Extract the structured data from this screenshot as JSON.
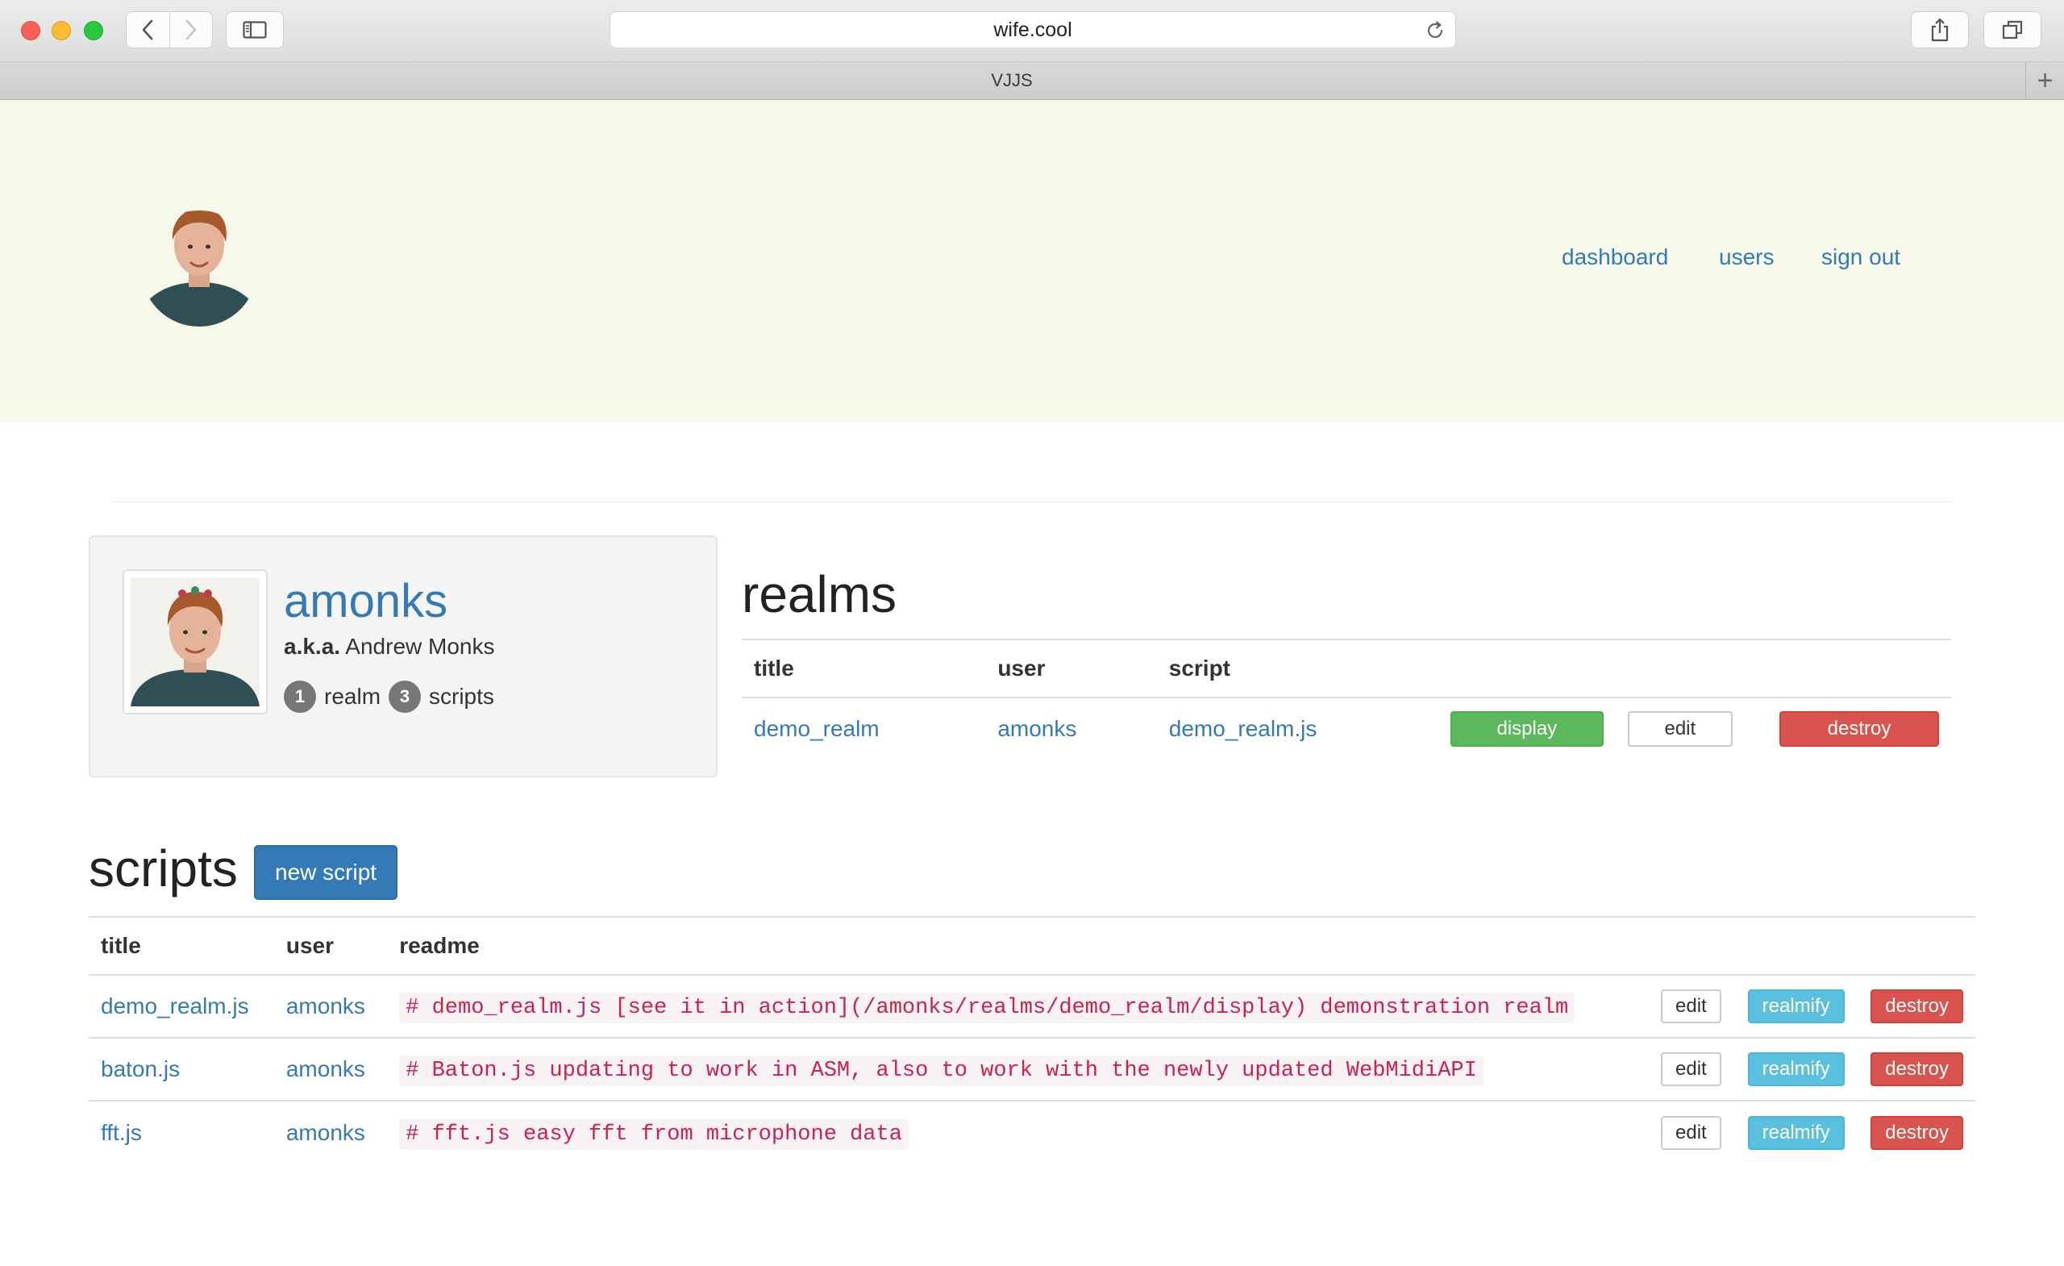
{
  "browser": {
    "url": "wife.cool",
    "tab_title": "VJJS",
    "new_tab_label": "+"
  },
  "nav": {
    "dashboard": "dashboard",
    "users": "users",
    "sign_out": "sign out"
  },
  "profile": {
    "username": "amonks",
    "aka_label": "a.k.a.",
    "real_name": "Andrew Monks",
    "realm_count": "1",
    "realm_word": "realm",
    "script_count": "3",
    "script_word": "scripts"
  },
  "realms": {
    "heading": "realms",
    "columns": {
      "title": "title",
      "user": "user",
      "script": "script"
    },
    "rows": [
      {
        "title": "demo_realm",
        "user": "amonks",
        "script": "demo_realm.js",
        "display": "display",
        "edit": "edit",
        "destroy": "destroy"
      }
    ]
  },
  "scripts": {
    "heading": "scripts",
    "new_button": "new script",
    "columns": {
      "title": "title",
      "user": "user",
      "readme": "readme"
    },
    "rows": [
      {
        "title": "demo_realm.js",
        "user": "amonks",
        "readme": "# demo_realm.js [see it in action](/amonks/realms/demo_realm/display) demonstration realm",
        "edit": "edit",
        "realmify": "realmify",
        "destroy": "destroy"
      },
      {
        "title": "baton.js",
        "user": "amonks",
        "readme": "# Baton.js updating to work in ASM, also to work with the newly updated WebMidiAPI",
        "edit": "edit",
        "realmify": "realmify",
        "destroy": "destroy"
      },
      {
        "title": "fft.js",
        "user": "amonks",
        "readme": "# fft.js easy fft from microphone data",
        "edit": "edit",
        "realmify": "realmify",
        "destroy": "destroy"
      }
    ]
  },
  "colors": {
    "link": "#337ab7",
    "header_bg": "#f6f8ea",
    "success": "#5cb85c",
    "danger": "#d9534f",
    "info": "#5bc0de",
    "primary": "#337ab7",
    "code_text": "#c7254e"
  },
  "icons": {
    "back": "chevron-left-icon",
    "forward": "chevron-right-icon",
    "sidebar": "sidebar-icon",
    "reload": "reload-icon",
    "share": "share-icon",
    "tabs": "tabs-overview-icon"
  }
}
